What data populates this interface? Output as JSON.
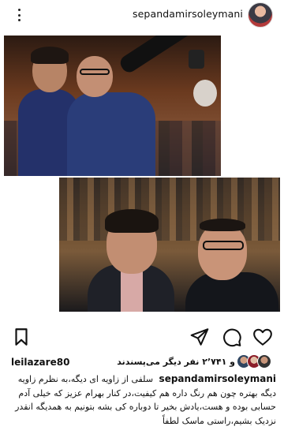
{
  "header": {
    "username": "sepandamirsoleymani",
    "menu_icon": "kebab-menu-icon",
    "avatar": "profile-avatar"
  },
  "media": {
    "photos": [
      {
        "description_icon": "selfie-photo-1"
      },
      {
        "description_icon": "selfie-photo-2"
      }
    ]
  },
  "actions": {
    "heart_icon": "heart-icon",
    "comment_icon": "comment-icon",
    "send_icon": "send-icon",
    "bookmark_icon": "bookmark-icon"
  },
  "likes": {
    "liked_by": "leilazare80",
    "count_text": "و ۲٬۷۴۱ نفر دیگر می‌پسندند"
  },
  "caption": {
    "username": "sepandamirsoleymani",
    "text": "سلفی از زاویه ای دیگه،به نظرم زاویه دیگه بهتره چون هم رنگ داره هم کیفیت،در کنار بهرام عزیز که خیلی آدم حسابی بوده و هست،یادش بخیر تا دوباره کی بشه بتونیم به همدیگه انقدر نزدیک بشیم،راستی ماسک لطفاً"
  },
  "colors": {
    "text": "#111111",
    "background": "#ffffff"
  }
}
